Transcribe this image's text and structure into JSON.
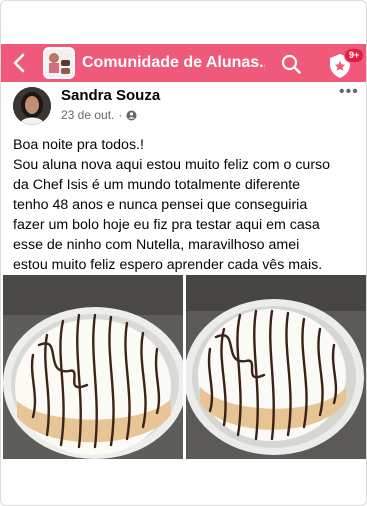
{
  "header": {
    "group_title": "Comunidade de Alunas...",
    "notification_count": "9+"
  },
  "post": {
    "author": "Sandra Souza",
    "time": "23 de out.",
    "separator": "·",
    "more": "•••",
    "lines": [
      "Boa noite pra todos.!",
      "Sou aluna nova aqui estou muito feliz com o curso",
      "da Chef Isis é um mundo totalmente diferente",
      "tenho 48 anos e nunca pensei que conseguiria",
      "fazer um bolo hoje eu fiz pra testar aqui em casa",
      "esse de ninho com Nutella, maravilhoso amei",
      "estou muito feliz espero aprender cada vês mais."
    ]
  },
  "colors": {
    "header_bg": "#ef5a7b",
    "badge_bg": "#e41e3f",
    "meta_text": "#65676b"
  },
  "icons": {
    "back": "chevron-left-icon",
    "search": "search-icon",
    "notifications": "shield-notification-icon",
    "audience": "group-audience-icon"
  }
}
